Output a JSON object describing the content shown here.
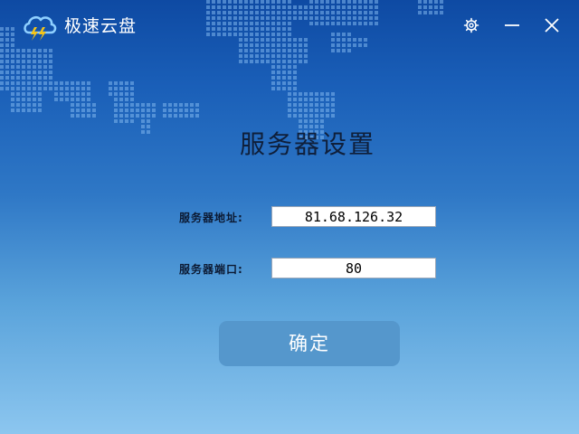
{
  "app": {
    "title": "极速云盘",
    "logo_icon": "cloud-lightning-icon"
  },
  "window_controls": {
    "settings_icon": "gear-icon",
    "minimize_icon": "minimize-icon",
    "close_icon": "close-icon"
  },
  "page": {
    "title": "服务器设置"
  },
  "form": {
    "address_label": "服务器地址:",
    "address_value": "81.68.126.32",
    "port_label": "服务器端口:",
    "port_value": "80",
    "confirm_label": "确定"
  },
  "colors": {
    "background_top": "#0e4aa3",
    "background_bottom": "#8cc6ef",
    "button": "#5597cc",
    "logo_cloud": "#8fd0ff",
    "logo_bolt": "#f5c518"
  }
}
